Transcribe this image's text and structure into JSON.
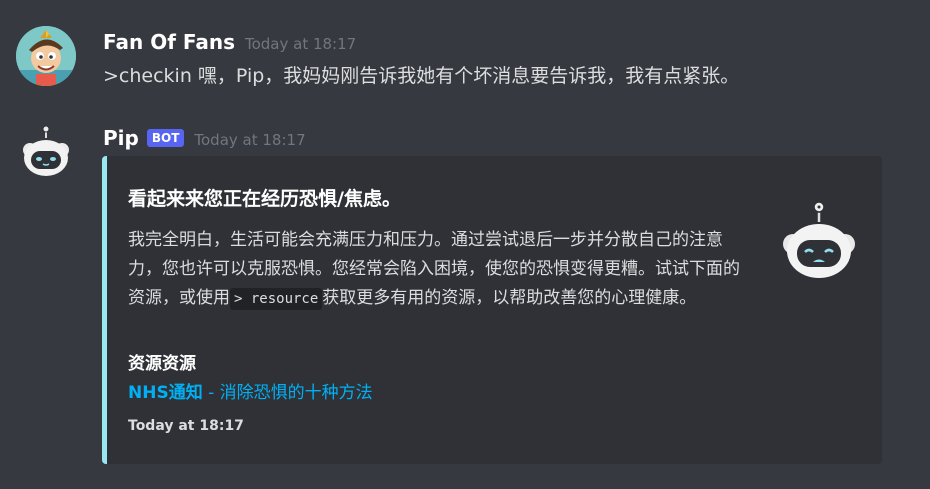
{
  "messages": [
    {
      "author": "Fan Of Fans",
      "timestamp": "Today at 18:17",
      "text": ">checkin 嘿，Pip，我妈妈刚告诉我她有个坏消息要告诉我，我有点紧张。",
      "avatar_icon": "user-avatar-cartoon"
    },
    {
      "author": "Pip",
      "badge": "BOT",
      "timestamp": "Today at 18:17",
      "avatar_icon": "robot-avatar",
      "embed": {
        "accent_color": "#98e8f2",
        "title": "看起来来您正在经历恐惧/焦虑。",
        "description_parts": [
          "我完全明白，生活可能会充满压力和压力。通过尝试退后一步并分散自己的注意力，您也许可以克服恐惧。您经常会陷入困境，使您的恐惧变得更糟。试试下面的资源，或使用",
          "> resource",
          "获取更多有用的资源，以帮助改善您的心理健康。"
        ],
        "field_name": "资源资源",
        "field_link_bold": "NHS通知",
        "field_link_rest": " - 消除恐惧的十种方法",
        "footer": "Today at 18:17",
        "thumbnail_icon": "sad-robot-icon"
      }
    }
  ]
}
